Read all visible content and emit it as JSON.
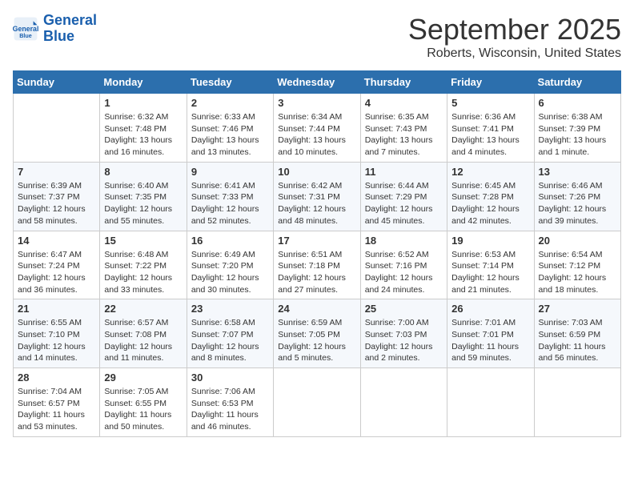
{
  "header": {
    "logo_line1": "General",
    "logo_line2": "Blue",
    "month": "September 2025",
    "location": "Roberts, Wisconsin, United States"
  },
  "days_of_week": [
    "Sunday",
    "Monday",
    "Tuesday",
    "Wednesday",
    "Thursday",
    "Friday",
    "Saturday"
  ],
  "weeks": [
    [
      {
        "day": "",
        "sunrise": "",
        "sunset": "",
        "daylight": ""
      },
      {
        "day": "1",
        "sunrise": "Sunrise: 6:32 AM",
        "sunset": "Sunset: 7:48 PM",
        "daylight": "Daylight: 13 hours and 16 minutes."
      },
      {
        "day": "2",
        "sunrise": "Sunrise: 6:33 AM",
        "sunset": "Sunset: 7:46 PM",
        "daylight": "Daylight: 13 hours and 13 minutes."
      },
      {
        "day": "3",
        "sunrise": "Sunrise: 6:34 AM",
        "sunset": "Sunset: 7:44 PM",
        "daylight": "Daylight: 13 hours and 10 minutes."
      },
      {
        "day": "4",
        "sunrise": "Sunrise: 6:35 AM",
        "sunset": "Sunset: 7:43 PM",
        "daylight": "Daylight: 13 hours and 7 minutes."
      },
      {
        "day": "5",
        "sunrise": "Sunrise: 6:36 AM",
        "sunset": "Sunset: 7:41 PM",
        "daylight": "Daylight: 13 hours and 4 minutes."
      },
      {
        "day": "6",
        "sunrise": "Sunrise: 6:38 AM",
        "sunset": "Sunset: 7:39 PM",
        "daylight": "Daylight: 13 hours and 1 minute."
      }
    ],
    [
      {
        "day": "7",
        "sunrise": "Sunrise: 6:39 AM",
        "sunset": "Sunset: 7:37 PM",
        "daylight": "Daylight: 12 hours and 58 minutes."
      },
      {
        "day": "8",
        "sunrise": "Sunrise: 6:40 AM",
        "sunset": "Sunset: 7:35 PM",
        "daylight": "Daylight: 12 hours and 55 minutes."
      },
      {
        "day": "9",
        "sunrise": "Sunrise: 6:41 AM",
        "sunset": "Sunset: 7:33 PM",
        "daylight": "Daylight: 12 hours and 52 minutes."
      },
      {
        "day": "10",
        "sunrise": "Sunrise: 6:42 AM",
        "sunset": "Sunset: 7:31 PM",
        "daylight": "Daylight: 12 hours and 48 minutes."
      },
      {
        "day": "11",
        "sunrise": "Sunrise: 6:44 AM",
        "sunset": "Sunset: 7:29 PM",
        "daylight": "Daylight: 12 hours and 45 minutes."
      },
      {
        "day": "12",
        "sunrise": "Sunrise: 6:45 AM",
        "sunset": "Sunset: 7:28 PM",
        "daylight": "Daylight: 12 hours and 42 minutes."
      },
      {
        "day": "13",
        "sunrise": "Sunrise: 6:46 AM",
        "sunset": "Sunset: 7:26 PM",
        "daylight": "Daylight: 12 hours and 39 minutes."
      }
    ],
    [
      {
        "day": "14",
        "sunrise": "Sunrise: 6:47 AM",
        "sunset": "Sunset: 7:24 PM",
        "daylight": "Daylight: 12 hours and 36 minutes."
      },
      {
        "day": "15",
        "sunrise": "Sunrise: 6:48 AM",
        "sunset": "Sunset: 7:22 PM",
        "daylight": "Daylight: 12 hours and 33 minutes."
      },
      {
        "day": "16",
        "sunrise": "Sunrise: 6:49 AM",
        "sunset": "Sunset: 7:20 PM",
        "daylight": "Daylight: 12 hours and 30 minutes."
      },
      {
        "day": "17",
        "sunrise": "Sunrise: 6:51 AM",
        "sunset": "Sunset: 7:18 PM",
        "daylight": "Daylight: 12 hours and 27 minutes."
      },
      {
        "day": "18",
        "sunrise": "Sunrise: 6:52 AM",
        "sunset": "Sunset: 7:16 PM",
        "daylight": "Daylight: 12 hours and 24 minutes."
      },
      {
        "day": "19",
        "sunrise": "Sunrise: 6:53 AM",
        "sunset": "Sunset: 7:14 PM",
        "daylight": "Daylight: 12 hours and 21 minutes."
      },
      {
        "day": "20",
        "sunrise": "Sunrise: 6:54 AM",
        "sunset": "Sunset: 7:12 PM",
        "daylight": "Daylight: 12 hours and 18 minutes."
      }
    ],
    [
      {
        "day": "21",
        "sunrise": "Sunrise: 6:55 AM",
        "sunset": "Sunset: 7:10 PM",
        "daylight": "Daylight: 12 hours and 14 minutes."
      },
      {
        "day": "22",
        "sunrise": "Sunrise: 6:57 AM",
        "sunset": "Sunset: 7:08 PM",
        "daylight": "Daylight: 12 hours and 11 minutes."
      },
      {
        "day": "23",
        "sunrise": "Sunrise: 6:58 AM",
        "sunset": "Sunset: 7:07 PM",
        "daylight": "Daylight: 12 hours and 8 minutes."
      },
      {
        "day": "24",
        "sunrise": "Sunrise: 6:59 AM",
        "sunset": "Sunset: 7:05 PM",
        "daylight": "Daylight: 12 hours and 5 minutes."
      },
      {
        "day": "25",
        "sunrise": "Sunrise: 7:00 AM",
        "sunset": "Sunset: 7:03 PM",
        "daylight": "Daylight: 12 hours and 2 minutes."
      },
      {
        "day": "26",
        "sunrise": "Sunrise: 7:01 AM",
        "sunset": "Sunset: 7:01 PM",
        "daylight": "Daylight: 11 hours and 59 minutes."
      },
      {
        "day": "27",
        "sunrise": "Sunrise: 7:03 AM",
        "sunset": "Sunset: 6:59 PM",
        "daylight": "Daylight: 11 hours and 56 minutes."
      }
    ],
    [
      {
        "day": "28",
        "sunrise": "Sunrise: 7:04 AM",
        "sunset": "Sunset: 6:57 PM",
        "daylight": "Daylight: 11 hours and 53 minutes."
      },
      {
        "day": "29",
        "sunrise": "Sunrise: 7:05 AM",
        "sunset": "Sunset: 6:55 PM",
        "daylight": "Daylight: 11 hours and 50 minutes."
      },
      {
        "day": "30",
        "sunrise": "Sunrise: 7:06 AM",
        "sunset": "Sunset: 6:53 PM",
        "daylight": "Daylight: 11 hours and 46 minutes."
      },
      {
        "day": "",
        "sunrise": "",
        "sunset": "",
        "daylight": ""
      },
      {
        "day": "",
        "sunrise": "",
        "sunset": "",
        "daylight": ""
      },
      {
        "day": "",
        "sunrise": "",
        "sunset": "",
        "daylight": ""
      },
      {
        "day": "",
        "sunrise": "",
        "sunset": "",
        "daylight": ""
      }
    ]
  ]
}
